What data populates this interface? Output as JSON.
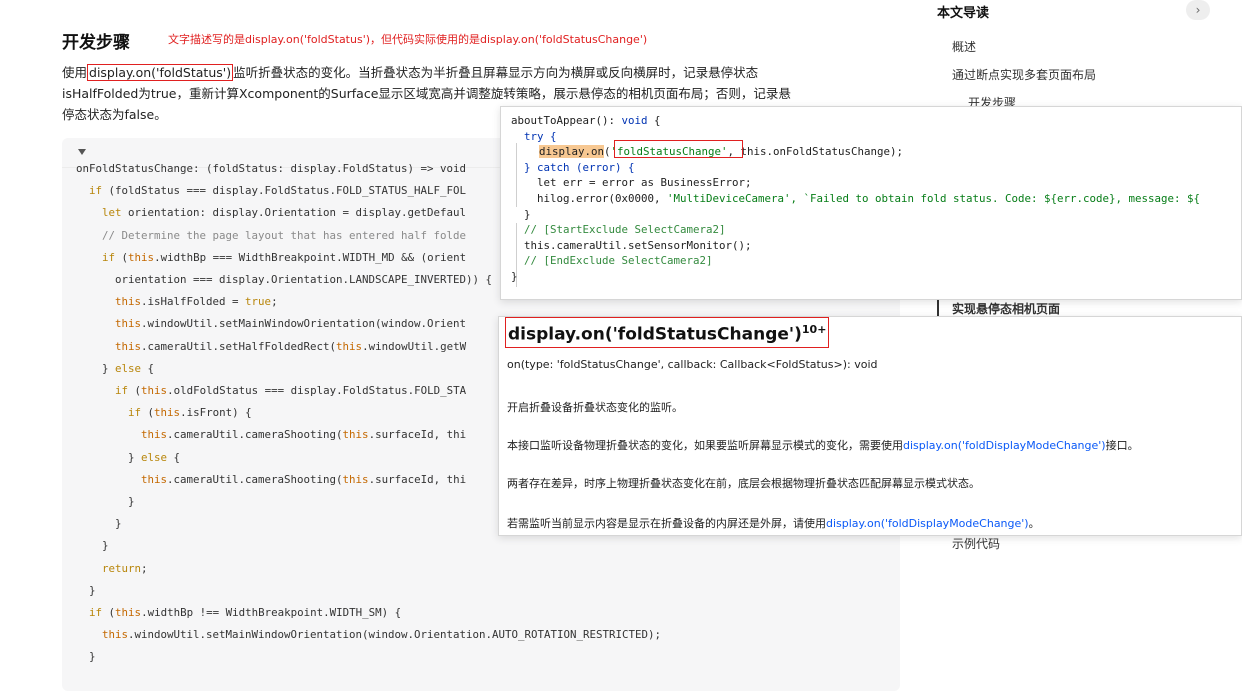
{
  "article": {
    "heading": "开发步骤",
    "annotation": "文字描述写的是display.on('foldStatus')，但代码实际使用的是display.on('foldStatusChange')",
    "para_prefix": "使用",
    "para_highlight": "display.on('foldStatus')",
    "para_line1_rest": "监听折叠状态的变化。当折叠状态为半折叠且屏幕显示方向为横屏或反向横屏时，记录悬停状态",
    "para_line2": "isHalfFolded为true，重新计算Xcomponent的Surface显示区域宽高并调整旋转策略，展示悬停态的相机页面布局；否则，记录悬",
    "para_line3": "停态状态为false。"
  },
  "code_block": {
    "lines": [
      "onFoldStatusChange: (foldStatus: display.FoldStatus) => void",
      "  if (foldStatus === display.FoldStatus.FOLD_STATUS_HALF_FOL",
      "    let orientation: display.Orientation = display.getDefaul",
      "    // Determine the page layout that has entered half folde",
      "    if (this.widthBp === WidthBreakpoint.WIDTH_MD && (orient",
      "      orientation === display.Orientation.LANDSCAPE_INVERTED)) {",
      "      this.isHalfFolded = true;",
      "      this.windowUtil.setMainWindowOrientation(window.Orient",
      "      this.cameraUtil.setHalfFoldedRect(this.windowUtil.getW",
      "    } else {",
      "      if (this.oldFoldStatus === display.FoldStatus.FOLD_STA",
      "        if (this.isFront) {",
      "          this.cameraUtil.cameraShooting(this.surfaceId, thi",
      "        } else {",
      "          this.cameraUtil.cameraShooting(this.surfaceId, thi",
      "        }",
      "      }",
      "    }",
      "    return;",
      "  }",
      "  if (this.widthBp !== WidthBreakpoint.WIDTH_SM) {",
      "    this.windowUtil.setMainWindowOrientation(window.Orientation.AUTO_ROTATION_RESTRICTED);",
      "  }"
    ]
  },
  "nav": {
    "title": "本文导读",
    "chevron": "›",
    "items": [
      "概述",
      "通过断点实现多套页面布局",
      "开发步骤",
      "实现悬停态相机页面",
      "示例代码"
    ]
  },
  "popup_code": {
    "l1a": "aboutToAppear(): ",
    "l1b": "void",
    "l1c": " {",
    "l2": "  try {",
    "l3_fn": "display.on",
    "l3_paren": "(",
    "l3_str": "'foldStatusChange'",
    "l3_rest": ", this.onFoldStatusChange);",
    "l4": "  } catch (error) {",
    "l5": "    let err = error as BusinessError;",
    "l6a": "    hilog.error(0x0000, ",
    "l6b": "'MultiDeviceCamera'",
    "l6c": ", `Failed to obtain fold status. Code: ${err.code}, message: ${",
    "l7": "  }",
    "l8": "  // [StartExclude SelectCamera2]",
    "l9": "  this.cameraUtil.setSensorMonitor();",
    "l10": "  // [EndExclude SelectCamera2]",
    "l11": "}"
  },
  "api_doc": {
    "title": "display.on('foldStatusChange')",
    "sup": "10+",
    "signature": "on(type: 'foldStatusChange', callback: Callback<FoldStatus>): void",
    "desc1": "开启折叠设备折叠状态变化的监听。",
    "desc2_pre": "本接口监听设备物理折叠状态的变化，如果要监听屏幕显示模式的变化，需要使用",
    "desc2_link": "display.on('foldDisplayModeChange')",
    "desc2_post": "接口。",
    "desc3": "两者存在差异，时序上物理折叠状态变化在前，底层会根据物理折叠状态匹配屏幕显示模式状态。",
    "desc4_pre": "若需监听当前显示内容是显示在折叠设备的内屏还是外屏，请使用",
    "desc4_link": "display.on('foldDisplayModeChange')",
    "desc4_post": "。"
  }
}
